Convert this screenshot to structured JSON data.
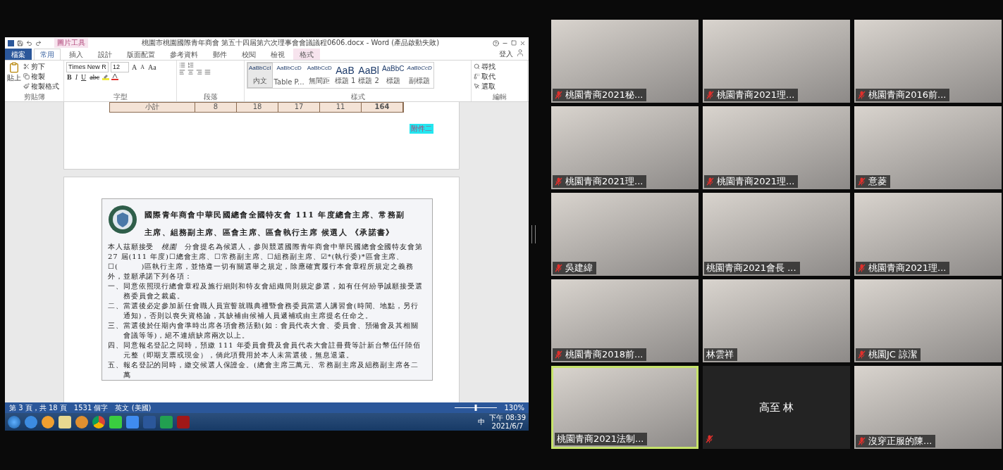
{
  "shared_screen": {
    "word": {
      "title": "桃園市桃園國際青年商會 第五十四屆第六次理事會會議議程0606.docx - Word (產品啟動失敗)",
      "context_tab": "圖片工具",
      "sign_in": "登入",
      "tabs": [
        {
          "label": "檔案",
          "kind": "file",
          "selected": false
        },
        {
          "label": "常用",
          "kind": "normal",
          "selected": true
        },
        {
          "label": "插入",
          "kind": "normal",
          "selected": false
        },
        {
          "label": "設計",
          "kind": "normal",
          "selected": false
        },
        {
          "label": "版面配置",
          "kind": "normal",
          "selected": false
        },
        {
          "label": "參考資料",
          "kind": "normal",
          "selected": false
        },
        {
          "label": "郵件",
          "kind": "normal",
          "selected": false
        },
        {
          "label": "校閱",
          "kind": "normal",
          "selected": false
        },
        {
          "label": "檢視",
          "kind": "normal",
          "selected": false
        },
        {
          "label": "格式",
          "kind": "context",
          "selected": false
        }
      ],
      "ribbon": {
        "clipboard": {
          "label": "剪貼簿",
          "paste": "貼上",
          "cut": "剪下",
          "copy": "複製",
          "format_painter": "複製格式"
        },
        "font": {
          "label": "字型",
          "name": "Times New R",
          "size": "12",
          "grow": "A",
          "shrink": "A",
          "case": "Aa",
          "bold": "B",
          "italic": "I",
          "underline": "U",
          "strike": "abc"
        },
        "paragraph": {
          "label": "段落"
        },
        "styles": {
          "label": "樣式",
          "items": [
            {
              "sample": "AaBbCcI",
              "name": "內文",
              "kind": "small",
              "selected": true
            },
            {
              "sample": "AaBbCcD",
              "name": "Table P...",
              "kind": "small",
              "selected": false
            },
            {
              "sample": "AaBbCcD",
              "name": "無間距",
              "kind": "small",
              "selected": false
            },
            {
              "sample": "AaB",
              "name": "標題 1",
              "kind": "large",
              "selected": false
            },
            {
              "sample": "AaBl",
              "name": "標題 2",
              "kind": "large",
              "selected": false
            },
            {
              "sample": "AaBbC",
              "name": "標題",
              "kind": "medium",
              "selected": false
            },
            {
              "sample": "AaBbCcD",
              "name": "副標題",
              "kind": "italic",
              "selected": false
            }
          ]
        },
        "editing": {
          "label": "編輯",
          "find": "尋找",
          "replace": "取代",
          "select": "選取"
        }
      },
      "document": {
        "table_row": [
          "小計",
          "8",
          "18",
          "17",
          "11",
          "164"
        ],
        "attachment_label": "附件二",
        "scan": {
          "title_lines": [
            "國際青年商會中華民國總會全國特友會 111 年度總會主席、常務副",
            "主席、組務副主席、區會主席、區會執行主席 候選人 《承諾書》"
          ],
          "intro": "本人茲願接受　*桃園*　分會提名為候選人，參與競選國際青年商會中華民國總會全國特友會第 27 屆(111 年度)☐總會主席、☐常務副主席、☐組務副主席、☑*(執行委)*區會主席、☐(　　　)區執行主席，並恪遵一切有關選舉之規定，除應確實履行本會章程所規定之義務外，並願承諾下列各項：",
          "items": [
            {
              "number": "一、",
              "text": "同意依照現行總會章程及施行細則和特友會組織簡則規定參選，如有任何紛爭誠願接受選務委員會之裁處。"
            },
            {
              "number": "二、",
              "text": "當選後必定參加新任會職人員宣誓就職典禮暨會務委員當選人講習會(時間、地點，另行通知)，否則以喪失資格論，其缺補由候補人員遞補或由主席提名任命之。"
            },
            {
              "number": "三、",
              "text": "當選後於任期內會準時出席各項會務活動(如：會員代表大會、委員會、預備會及其相關會議等等)，絕不連續缺席兩次以上。"
            },
            {
              "number": "四、",
              "text": "同意報名登記之同時，預繳 111 年委員會費及會員代表大會註冊費等計新台幣伍仟陸佰元整（即期支票或現金），倘此項費用於本人未當選後，無息退還。"
            },
            {
              "number": "五、",
              "text": "報名登記的同時，繳交候選人保證金。(總會主席三萬元、常務副主席及組務副主席各二萬"
            }
          ]
        }
      },
      "status_bar": {
        "page": "第 3 頁，共 18 頁",
        "words": "1531 個字",
        "language": "英文 (美國)",
        "zoom": "130%",
        "zoom_slider": {
          "level": 0.5
        }
      }
    },
    "taskbar": {
      "ime": "中",
      "time": "下午 08:39",
      "date": "2021/6/7"
    }
  },
  "gallery": [
    {
      "name": "桃園青商2021秘...",
      "muted": true,
      "video": true,
      "speaking": false
    },
    {
      "name": "桃園青商2021理...",
      "muted": true,
      "video": true,
      "speaking": false
    },
    {
      "name": "桃園青商2016前...",
      "muted": true,
      "video": true,
      "speaking": false
    },
    {
      "name": "桃園青商2021理...",
      "muted": true,
      "video": true,
      "speaking": false
    },
    {
      "name": "桃園青商2021理...",
      "muted": true,
      "video": true,
      "speaking": false
    },
    {
      "name": "意菱",
      "muted": true,
      "video": true,
      "speaking": false
    },
    {
      "name": "吳建緯",
      "muted": true,
      "video": true,
      "speaking": false
    },
    {
      "name": "桃園青商2021會長 ...",
      "muted": false,
      "video": true,
      "speaking": false
    },
    {
      "name": "桃園青商2021理...",
      "muted": true,
      "video": true,
      "speaking": false
    },
    {
      "name": "桃園青商2018前...",
      "muted": true,
      "video": true,
      "speaking": false
    },
    {
      "name": "林雲祥",
      "muted": false,
      "video": true,
      "speaking": false
    },
    {
      "name": "桃園JC 諒潔",
      "muted": true,
      "video": true,
      "speaking": false
    },
    {
      "name": "桃園青商2021法制...",
      "muted": false,
      "video": true,
      "speaking": true
    },
    {
      "name": "高至 林",
      "muted": true,
      "video": false,
      "speaking": false
    },
    {
      "name": "沒穿正服的陳...",
      "muted": true,
      "video": true,
      "speaking": false
    }
  ]
}
